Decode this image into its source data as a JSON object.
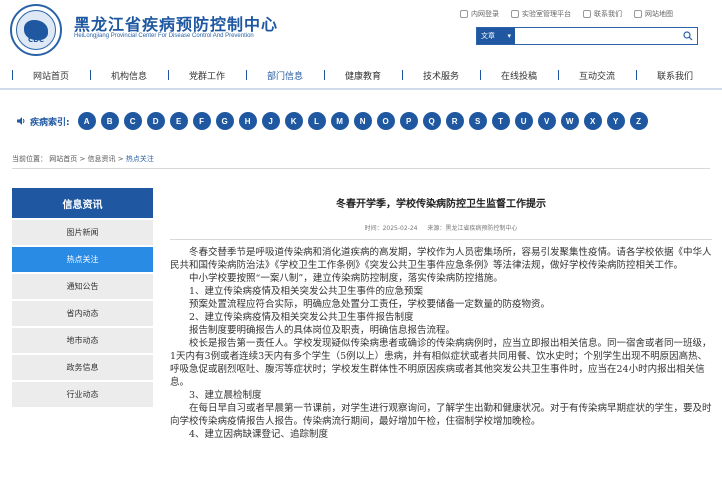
{
  "header": {
    "site_title": "黑龙江省疾病预防控制中心",
    "site_subtitle": "HeiLongjiang Provincial Center For Disease Control And Prevention",
    "logo_text": "CDC",
    "top_links": [
      {
        "label": "内网登录",
        "icon": "login-icon"
      },
      {
        "label": "实验室管理平台",
        "icon": "lab-icon"
      },
      {
        "label": "联系我们",
        "icon": "contact-icon"
      },
      {
        "label": "网站地图",
        "icon": "sitemap-icon"
      }
    ],
    "search": {
      "scope": "文章",
      "placeholder": "",
      "icon": "search-icon"
    }
  },
  "nav": {
    "items": [
      "网站首页",
      "机构信息",
      "党群工作",
      "部门信息",
      "健康教育",
      "技术服务",
      "在线投稿",
      "互动交流",
      "联系我们"
    ],
    "active_index": 3
  },
  "index": {
    "label": "疾病索引:",
    "letters": [
      "A",
      "B",
      "C",
      "D",
      "E",
      "F",
      "G",
      "H",
      "J",
      "K",
      "L",
      "M",
      "N",
      "O",
      "P",
      "Q",
      "R",
      "S",
      "T",
      "U",
      "V",
      "W",
      "X",
      "Y",
      "Z"
    ]
  },
  "breadcrumb": {
    "prefix": "当前位置：",
    "items": [
      "网站首页",
      "信息资讯",
      "热点关注"
    ],
    "separator": " > "
  },
  "sidebar": {
    "title": "信息资讯",
    "items": [
      "图片新闻",
      "热点关注",
      "通知公告",
      "省内动态",
      "地市动态",
      "政务信息",
      "行业动态"
    ],
    "active_index": 1
  },
  "article": {
    "title": "冬春开学季，学校传染病防控卫生监督工作提示",
    "time": "时间：2025-02-24",
    "source": "来源：黑龙江省疾病预防控制中心",
    "paragraphs": [
      {
        "text": "冬春交替季节是呼吸道传染病和消化道疾病的高发期，学校作为人员密集场所，容易引发聚集性疫情。请各学校依据《中华人民共和国传染病防治法》《学校卫生工作条例》《突发公共卫生事件应急条例》等法律法规，做好学校传染病防控相关工作。",
        "indent": true
      },
      {
        "text": "中小学校要按照“一案八制”，建立传染病防控制度，落实传染病防控措施。",
        "indent": true
      },
      {
        "text": "1、建立传染病疫情及相关突发公共卫生事件的应急预案",
        "indent": true
      },
      {
        "text": "预案处置流程应符合实际，明确应急处置分工责任，学校要储备一定数量的防疫物资。",
        "indent": true
      },
      {
        "text": "2、建立传染病疫情及相关突发公共卫生事件报告制度",
        "indent": true
      },
      {
        "text": "报告制度要明确报告人的具体岗位及职责，明确信息报告流程。",
        "indent": true
      },
      {
        "text": "校长是报告第一责任人。学校发现疑似传染病患者或确诊的传染病病例时，应当立即报出相关信息。同一宿舍或者同一班级，1天内有3例或者连续3天内有多个学生（5例以上）患病，并有相似症状或者共同用餐、饮水史时；个别学生出现不明原因高热、呼吸急促或剧烈呕吐、腹泻等症状时；学校发生群体性不明原因疾病或者其他突发公共卫生事件时，应当在24小时内报出相关信息。",
        "indent": true
      },
      {
        "text": "3、建立晨检制度",
        "indent": true
      },
      {
        "text": "在每日早自习或者早晨第一节课前，对学生进行观察询问，了解学生出勤和健康状况。对于有传染病早期症状的学生，要及时向学校传染病疫情报告人报告。传染病流行期间，最好增加午检，住宿制学校增加晚检。",
        "indent": true
      },
      {
        "text": "4、建立因病缺课登记、追踪制度",
        "indent": true
      }
    ]
  }
}
